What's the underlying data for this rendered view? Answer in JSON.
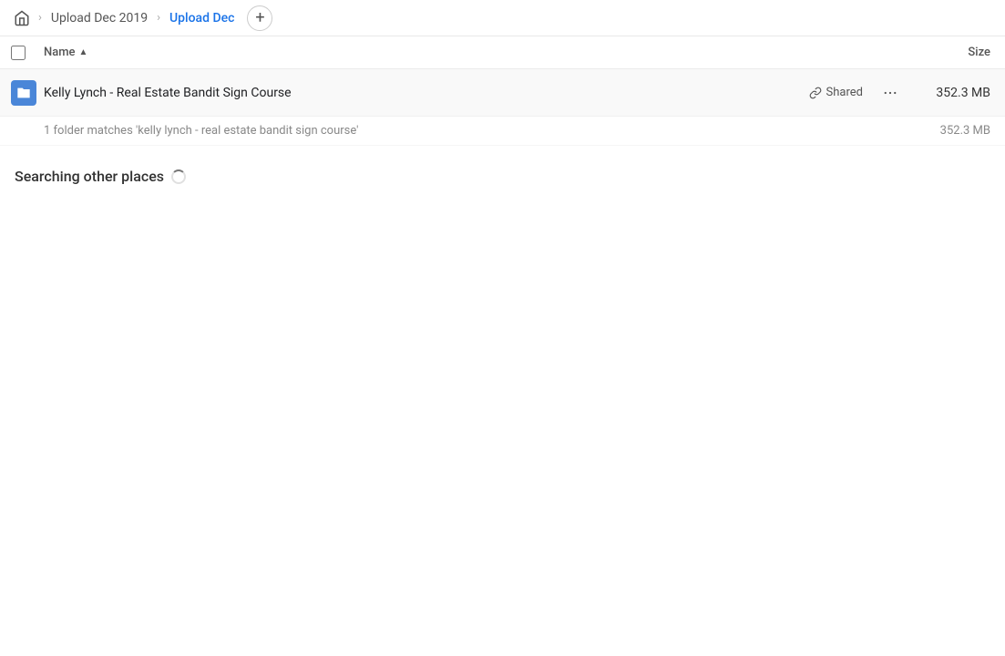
{
  "breadcrumb": {
    "home_icon": "🏠",
    "items": [
      {
        "label": "Upload Dec 2019",
        "active": false
      },
      {
        "label": "Upload Dec",
        "active": true
      }
    ],
    "add_button_label": "+"
  },
  "columns": {
    "name_label": "Name",
    "sort_arrow": "▲",
    "size_label": "Size"
  },
  "file_row": {
    "name": "Kelly Lynch - Real Estate Bandit Sign Course",
    "shared_label": "Shared",
    "size": "352.3 MB",
    "more_icon": "•••"
  },
  "match_info": {
    "text": "1 folder matches 'kelly lynch - real estate bandit sign course'",
    "size": "352.3 MB"
  },
  "searching_section": {
    "title": "Searching other places"
  }
}
